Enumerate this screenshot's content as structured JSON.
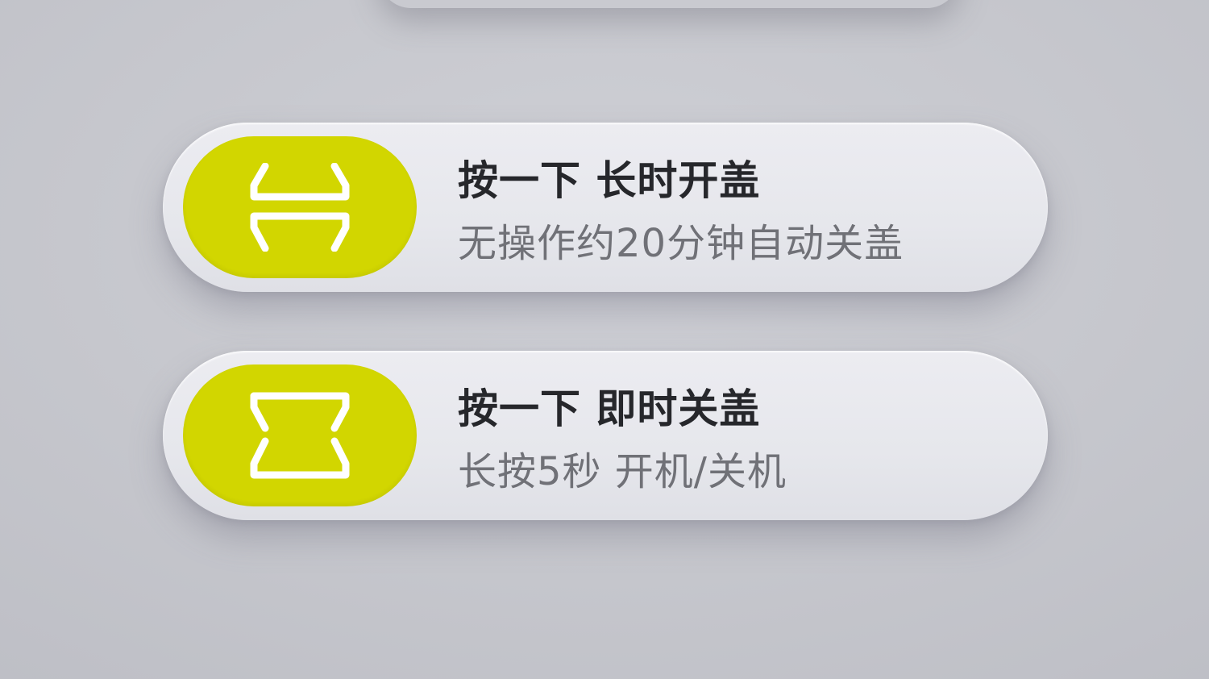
{
  "colors": {
    "accent": "#d2d600",
    "card_background": "#e7e8ed",
    "page_background": "#c8c9cf",
    "title_text": "#26272b",
    "subtitle_text": "#707177",
    "icon_stroke": "#ffffff"
  },
  "instructions": [
    {
      "icon": "lid-open-icon",
      "title": "按一下 长时开盖",
      "subtitle": "无操作约20分钟自动关盖"
    },
    {
      "icon": "lid-close-icon",
      "title": "按一下 即时关盖",
      "subtitle": "长按5秒 开机/关机"
    }
  ]
}
